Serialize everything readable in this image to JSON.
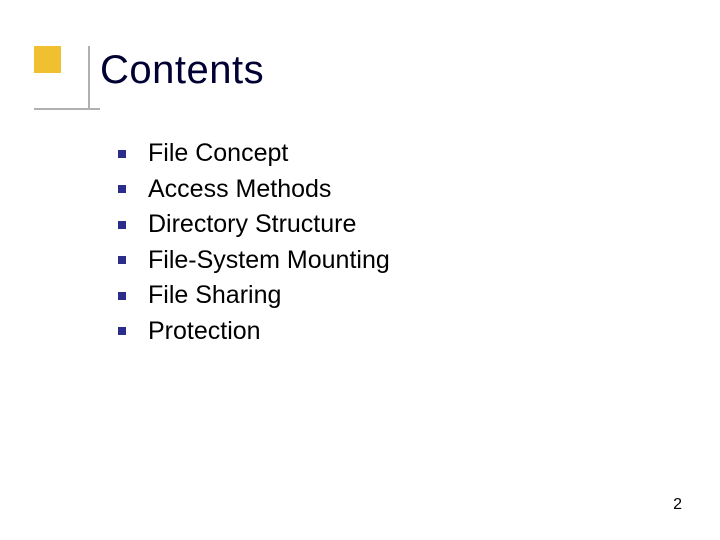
{
  "title": "Contents",
  "items": [
    "File Concept",
    "Access Methods",
    "Directory Structure",
    "File-System Mounting",
    "File Sharing",
    "Protection"
  ],
  "page_number": "2"
}
